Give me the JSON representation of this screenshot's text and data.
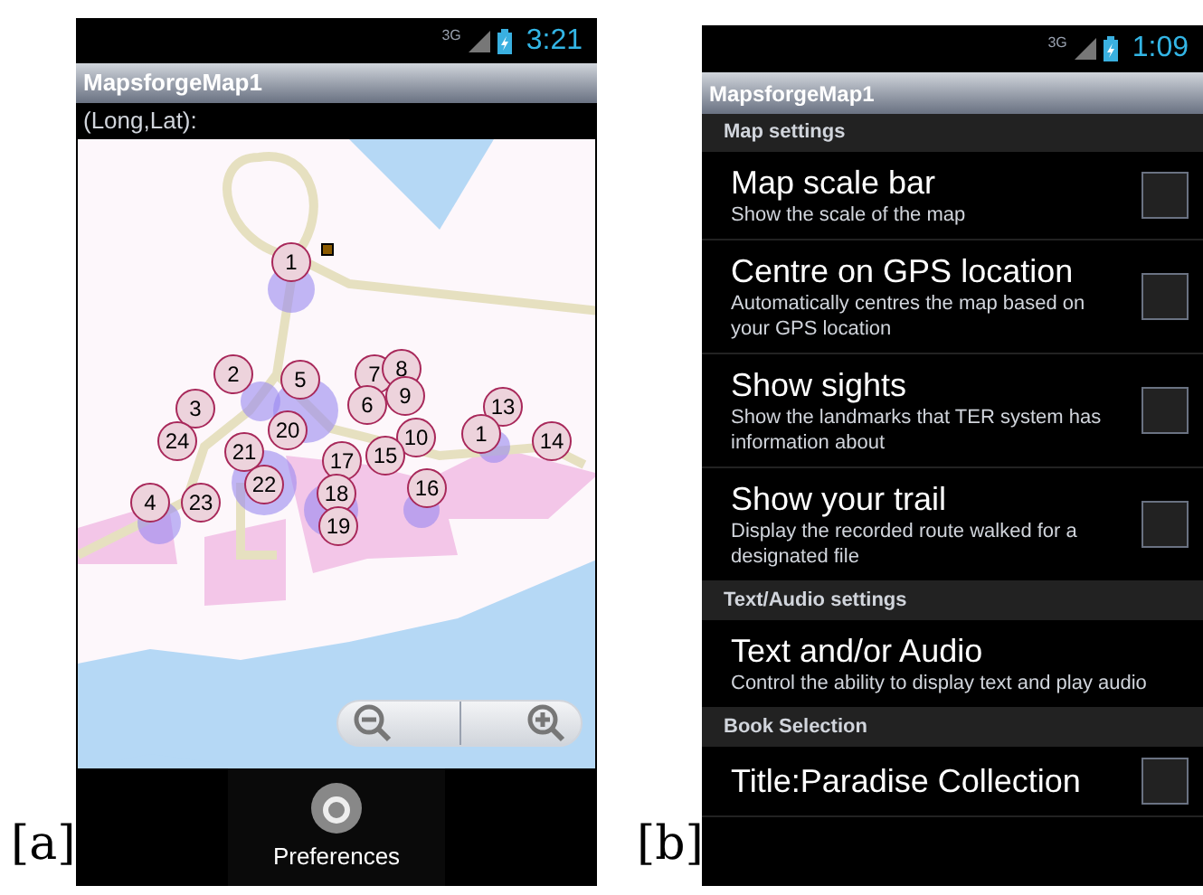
{
  "panels": [
    {
      "label": "[a]",
      "kind": "map",
      "status_bar": {
        "network": "3G",
        "time": "3:21"
      },
      "title": "MapsforgeMap1",
      "coordinates_label": "(Long,Lat):",
      "markers": [
        {
          "number": "1"
        },
        {
          "number": "2"
        },
        {
          "number": "5"
        },
        {
          "number": "7"
        },
        {
          "number": "8"
        },
        {
          "number": "3"
        },
        {
          "number": "6"
        },
        {
          "number": "9"
        },
        {
          "number": "13"
        },
        {
          "number": "24"
        },
        {
          "number": "21"
        },
        {
          "number": "20"
        },
        {
          "number": "10"
        },
        {
          "number": "1"
        },
        {
          "number": "14"
        },
        {
          "number": "17"
        },
        {
          "number": "15"
        },
        {
          "number": "4"
        },
        {
          "number": "23"
        },
        {
          "number": "22"
        },
        {
          "number": "18"
        },
        {
          "number": "16"
        },
        {
          "number": "19"
        }
      ],
      "bottom_menu": [
        {
          "label": "Preferences"
        }
      ]
    },
    {
      "label": "[b]",
      "kind": "settings",
      "status_bar": {
        "network": "3G",
        "time": "1:09"
      },
      "title": "MapsforgeMap1",
      "sections": [
        {
          "header": "Map settings",
          "items": [
            {
              "title": "Map scale bar",
              "summary": "Show the scale of the map",
              "checked": false
            },
            {
              "title": "Centre on GPS location",
              "summary": "Automatically centres the map based on your GPS location",
              "checked": false
            },
            {
              "title": "Show sights",
              "summary": "Show the landmarks that TER system has information about",
              "checked": false
            },
            {
              "title": "Show your trail",
              "summary": "Display the recorded route walked for a designated file",
              "checked": false
            }
          ]
        },
        {
          "header": "Text/Audio settings",
          "items": [
            {
              "title": "Text and/or Audio",
              "summary": "Control the ability to display text and play audio"
            }
          ]
        },
        {
          "header": "Book Selection",
          "items": [
            {
              "title": "Title:Paradise Collection",
              "checked": false
            }
          ]
        }
      ]
    }
  ]
}
